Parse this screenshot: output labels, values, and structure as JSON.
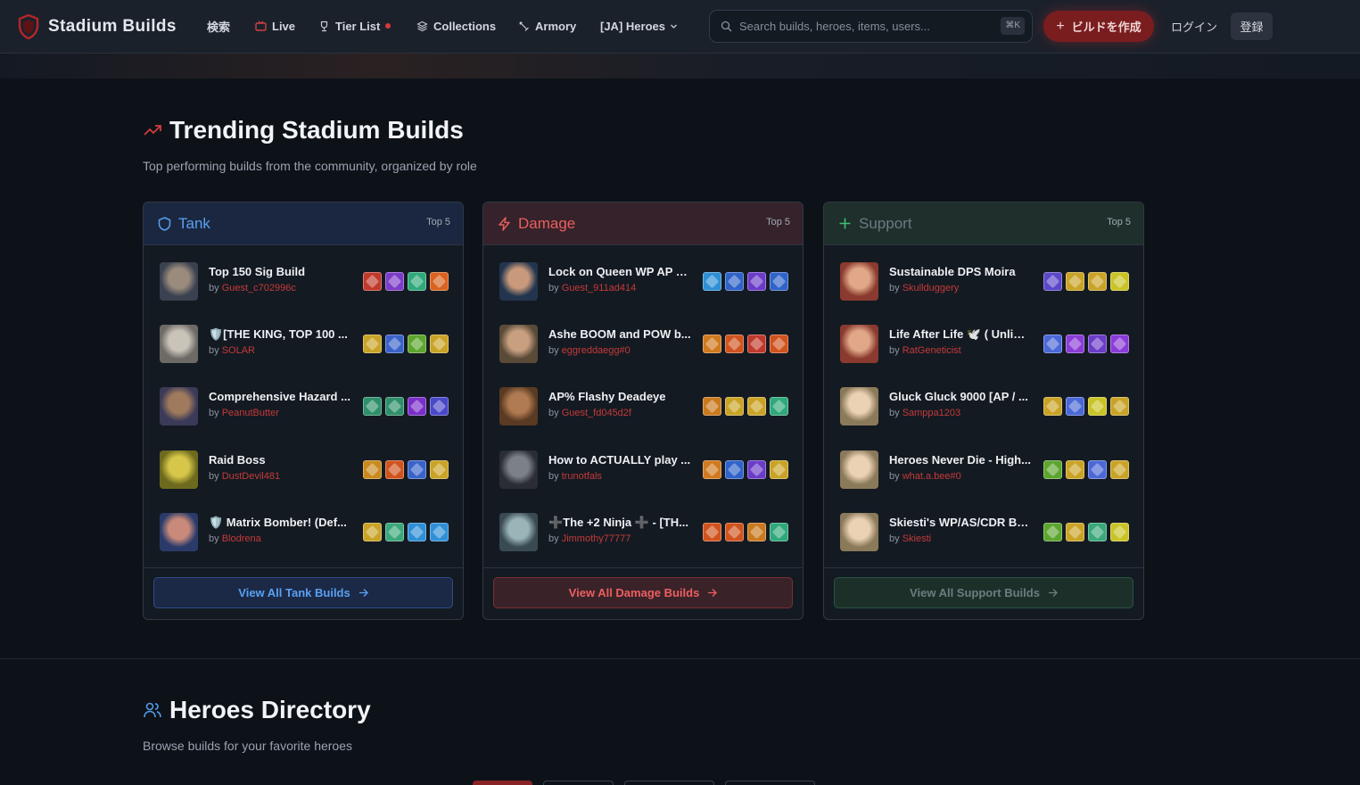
{
  "nav": {
    "brand": "Stadium Builds",
    "links": [
      {
        "label": "検索",
        "icon": "none"
      },
      {
        "label": "Live",
        "icon": "tv-icon"
      },
      {
        "label": "Tier List",
        "icon": "trophy-icon"
      },
      {
        "label": "Collections",
        "icon": "layers-icon"
      },
      {
        "label": "Armory",
        "icon": "sword-icon"
      },
      {
        "label": "[JA] Heroes",
        "icon": "chevron-down-icon"
      }
    ],
    "search_placeholder": "Search builds, heroes, items, users...",
    "search_shortcut": "⌘K",
    "create_label": "ビルドを作成",
    "login_label": "ログイン",
    "register_label": "登録"
  },
  "trending": {
    "title": "Trending Stadium Builds",
    "subtitle": "Top performing builds from the community, organized by role"
  },
  "roles": [
    {
      "name": "Tank",
      "badge": "Top 5",
      "view_all": "View All Tank Builds",
      "color": "#5aa0f0",
      "builds": [
        {
          "title": "Top 150 Sig Build",
          "by": "by",
          "author": "Guest_c702996c",
          "avatar": [
            "#3a4150",
            "#9a8b7c"
          ],
          "items": [
            "#c0392b",
            "#7d3cc8",
            "#2fa87a",
            "#d9621f"
          ]
        },
        {
          "title": "🛡️[THE KING, TOP 100 ...",
          "by": "by",
          "author": "SOLAR",
          "avatar": [
            "#6d6a66",
            "#c9c3b8"
          ],
          "items": [
            "#c9a326",
            "#3a63c9",
            "#5ca52e",
            "#c9a326"
          ]
        },
        {
          "title": "Comprehensive Hazard ...",
          "by": "by",
          "author": "PeanutButter",
          "avatar": [
            "#3b3a58",
            "#a07a5c"
          ],
          "items": [
            "#2e8f6a",
            "#2e8f6a",
            "#7a2fc8",
            "#4a48c8"
          ]
        },
        {
          "title": "Raid Boss",
          "by": "by",
          "author": "DustDevil481",
          "avatar": [
            "#6d6a1e",
            "#d6c64a"
          ],
          "items": [
            "#c98a1e",
            "#d0531e",
            "#3a63c9",
            "#c9a326"
          ]
        },
        {
          "title": "🛡️ Matrix Bomber! (Def...",
          "by": "by",
          "author": "Blodrena",
          "avatar": [
            "#2a3a6a",
            "#c98a7a"
          ],
          "items": [
            "#c9a326",
            "#3aa87a",
            "#2f8fd6",
            "#2f8fd6"
          ]
        }
      ]
    },
    {
      "name": "Damage",
      "badge": "Top 5",
      "view_all": "View All Damage Builds",
      "color": "#ec5f5f",
      "builds": [
        {
          "title": "Lock on Queen WP AP B...",
          "by": "by",
          "author": "Guest_911ad414",
          "avatar": [
            "#23354e",
            "#c8997a"
          ],
          "items": [
            "#2f8fd6",
            "#2f63c9",
            "#6a3cc8",
            "#2f63c9"
          ]
        },
        {
          "title": "Ashe BOOM and POW b...",
          "by": "by",
          "author": "eggreddaegg#0",
          "avatar": [
            "#5a4a38",
            "#c8a080"
          ],
          "items": [
            "#d0791e",
            "#d0531e",
            "#c0392b",
            "#d0531e"
          ]
        },
        {
          "title": "AP% Flashy Deadeye",
          "by": "by",
          "author": "Guest_fd045d2f",
          "avatar": [
            "#5a3a22",
            "#b07a52"
          ],
          "items": [
            "#c9791e",
            "#c9a326",
            "#c9a326",
            "#2fa87a"
          ]
        },
        {
          "title": "How to ACTUALLY play ...",
          "by": "by",
          "author": "trunotfals",
          "avatar": [
            "#2a2d33",
            "#7c8088"
          ],
          "items": [
            "#d0791e",
            "#2f63c9",
            "#6a3cc8",
            "#c9a326"
          ]
        },
        {
          "title": "➕The +2 Ninja ➕ - [TH...",
          "by": "by",
          "author": "Jimmothy77777",
          "avatar": [
            "#3a4a52",
            "#9ab4b8"
          ],
          "items": [
            "#d0531e",
            "#d0531e",
            "#c9791e",
            "#2fa87a"
          ]
        }
      ]
    },
    {
      "name": "Support",
      "badge": "Top 5",
      "view_all": "View All Support Builds",
      "color": "#3fbf6f",
      "builds": [
        {
          "title": "Sustainable DPS Moira",
          "by": "by",
          "author": "Skullduggery",
          "avatar": [
            "#8a3a2e",
            "#e0a888"
          ],
          "items": [
            "#5a48c8",
            "#c9a326",
            "#c9a326",
            "#c9c326"
          ]
        },
        {
          "title": "Life After Life 🕊️ ( Unlim...",
          "by": "by",
          "author": "RatGeneticist",
          "avatar": [
            "#8a3a2e",
            "#e0a888"
          ],
          "items": [
            "#4a68d6",
            "#8a3cd6",
            "#6a3cc8",
            "#8a3cd6"
          ]
        },
        {
          "title": "Gluck Gluck 9000 [AP / ...",
          "by": "by",
          "author": "Samppa1203",
          "avatar": [
            "#8a7a5a",
            "#ecd2b4"
          ],
          "items": [
            "#c9a326",
            "#4a68d6",
            "#c9c326",
            "#c9a326"
          ]
        },
        {
          "title": "Heroes Never Die - High...",
          "by": "by",
          "author": "what.a.bee#0",
          "avatar": [
            "#8a7a5a",
            "#ecd2b4"
          ],
          "items": [
            "#5ca52e",
            "#c9a326",
            "#4a68d6",
            "#c9a326"
          ]
        },
        {
          "title": "Skiesti's WP/AS/CDR Bu...",
          "by": "by",
          "author": "Skiesti",
          "avatar": [
            "#8a7a5a",
            "#ecd2b4"
          ],
          "items": [
            "#5ca52e",
            "#c9a326",
            "#3aa87a",
            "#c9c326"
          ]
        }
      ]
    }
  ],
  "directory": {
    "title": "Heroes Directory",
    "subtitle": "Browse builds for your favorite heroes"
  }
}
